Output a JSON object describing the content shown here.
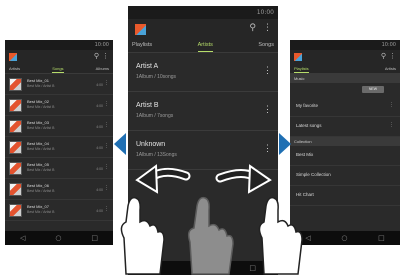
{
  "status_time": "10:00",
  "left_phone": {
    "tabs": [
      "Artists",
      "Songs",
      "Albums"
    ],
    "active_tab": 1,
    "songs": [
      {
        "title": "Best Mix_01",
        "sub": "Best Mix / Artist B",
        "dur": "4:00"
      },
      {
        "title": "Best Mix_02",
        "sub": "Best Mix / Artist B",
        "dur": "4:00"
      },
      {
        "title": "Best Mix_03",
        "sub": "Best Mix / Artist B",
        "dur": "4:00"
      },
      {
        "title": "Best Mix_04",
        "sub": "Best Mix / Artist B",
        "dur": "4:00"
      },
      {
        "title": "Best Mix_05",
        "sub": "Best Mix / Artist B",
        "dur": "4:00"
      },
      {
        "title": "Best Mix_06",
        "sub": "Best Mix / Artist B",
        "dur": "4:00"
      },
      {
        "title": "Best Mix_07",
        "sub": "Best Mix / Artist B",
        "dur": "4:00"
      }
    ]
  },
  "center_phone": {
    "tabs": [
      "Playlists",
      "Artists",
      "Songs"
    ],
    "active_tab": 1,
    "artists": [
      {
        "name": "Artist A",
        "meta": "1Album / 10songs"
      },
      {
        "name": "Artist B",
        "meta": "1Album / 7songs"
      },
      {
        "name": "Unknown",
        "meta": "1Album / 13Songs"
      }
    ]
  },
  "right_phone": {
    "tabs": [
      "Playlists",
      "Artists"
    ],
    "active_tab": 0,
    "section_music": "Music",
    "new_button": "NEW",
    "favorites": [
      {
        "label": "My favorite"
      },
      {
        "label": "Latest songs"
      }
    ],
    "section_collection": "Collection",
    "collections": [
      {
        "label": "Best Mix"
      },
      {
        "label": "Simple Collection"
      },
      {
        "label": "Hit Chart"
      }
    ]
  },
  "icons": {
    "search": "search-icon",
    "more": "more-vert-icon",
    "back": "back-icon",
    "home": "home-icon",
    "recents": "recents-icon"
  },
  "colors": {
    "accent_green": "#b6dd6a",
    "arrow_blue": "#1f6fb3",
    "screen_bg": "#2a2a2a"
  }
}
